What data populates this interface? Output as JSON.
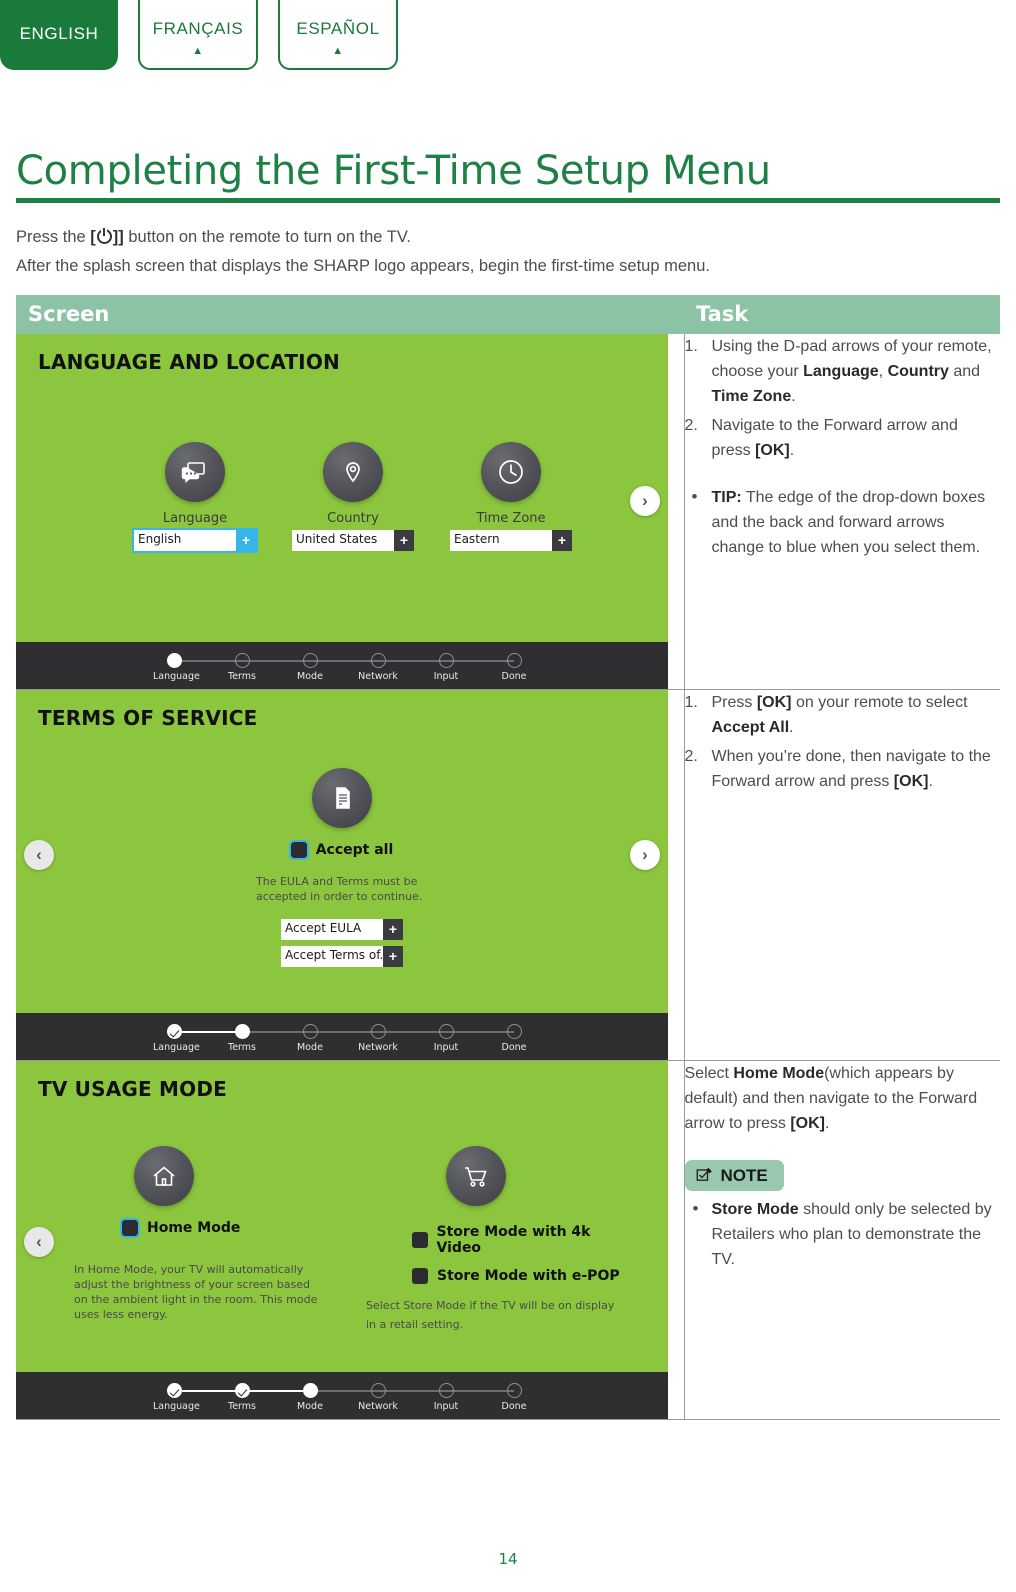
{
  "language_tabs": [
    {
      "label": "ENGLISH",
      "active": true
    },
    {
      "label": "FRANÇAIS",
      "active": false
    },
    {
      "label": "ESPAÑOL",
      "active": false
    }
  ],
  "page_title": "Completing the First-Time Setup Menu",
  "intro": {
    "line1_a": "Press the ",
    "line1_b": "[",
    "line1_c": "]]",
    "line1_d": " button on the remote to turn on the TV.",
    "line2": "After the splash screen that displays the SHARP logo appears, begin the first-time setup menu."
  },
  "table_headers": {
    "screen": "Screen",
    "task": "Task"
  },
  "colors": {
    "brand_green": "#1e8045",
    "tv_green": "#8cc63e",
    "header_sage": "#8dc3a5",
    "highlight_blue": "#35b6e8",
    "footer_dark": "#2f2f32",
    "note_green": "#9ac8ae"
  },
  "steps": [
    "Language",
    "Terms",
    "Mode",
    "Network",
    "Input",
    "Done"
  ],
  "row1": {
    "screen_title": "LANGUAGE AND LOCATION",
    "options": [
      {
        "label": "Language",
        "value": "English",
        "icon": "chat-bubble-icon",
        "selected": true
      },
      {
        "label": "Country",
        "value": "United States",
        "icon": "location-pin-icon",
        "selected": false
      },
      {
        "label": "Time Zone",
        "value": "Eastern",
        "icon": "clock-icon",
        "selected": false
      }
    ],
    "plus_symbol": "+",
    "forward_arrow": "›",
    "current_step": "Language",
    "tasks": [
      {
        "parts": [
          {
            "t": "Using the D-pad arrows of your remote, choose your ",
            "b": false
          },
          {
            "t": "Language",
            "b": true
          },
          {
            "t": ", ",
            "b": false
          },
          {
            "t": "Country",
            "b": true
          },
          {
            "t": " and ",
            "b": false
          },
          {
            "t": "Time Zone",
            "b": true
          },
          {
            "t": ".",
            "b": false
          }
        ]
      },
      {
        "parts": [
          {
            "t": "Navigate to the Forward arrow and press ",
            "b": false
          },
          {
            "t": "[OK]",
            "b": true
          },
          {
            "t": ".",
            "b": false
          }
        ]
      }
    ],
    "tip": [
      {
        "t": "TIP:",
        "b": true
      },
      {
        "t": " The edge of the drop-down boxes and the back and forward arrows change to blue when you select them.",
        "b": false
      }
    ]
  },
  "row2": {
    "screen_title": "TERMS OF SERVICE",
    "icon": "document-icon",
    "accept_all_label": "Accept all",
    "helper_text": "The EULA and Terms must be accepted in order to continue.",
    "dropdowns": [
      {
        "value": "Accept EULA"
      },
      {
        "value": "Accept Terms of..."
      }
    ],
    "plus_symbol": "+",
    "back_arrow": "‹",
    "forward_arrow": "›",
    "current_step": "Terms",
    "completed_steps": [
      "Language"
    ],
    "tasks": [
      {
        "parts": [
          {
            "t": "Press ",
            "b": false
          },
          {
            "t": "[OK]",
            "b": true
          },
          {
            "t": " on your remote to select ",
            "b": false
          },
          {
            "t": "Accept All",
            "b": true
          },
          {
            "t": ".",
            "b": false
          }
        ]
      },
      {
        "parts": [
          {
            "t": "When you’re done, then navigate to the Forward arrow and press ",
            "b": false
          },
          {
            "t": "[OK]",
            "b": true
          },
          {
            "t": ".",
            "b": false
          }
        ]
      }
    ]
  },
  "row3": {
    "screen_title": "TV USAGE MODE",
    "home": {
      "icon": "home-icon",
      "label": "Home Mode",
      "selected": true,
      "description": "In Home Mode, your TV will automatically adjust the brightness of your screen based on the ambient light in the room. This mode uses less energy."
    },
    "store": {
      "icon": "shopping-cart-icon",
      "options": [
        {
          "label": "Store Mode with 4k Video",
          "selected": false
        },
        {
          "label": "Store Mode with e-POP",
          "selected": false
        }
      ],
      "description": "Select Store Mode if the TV will be on display in a retail setting."
    },
    "back_arrow": "‹",
    "current_step": "Mode",
    "completed_steps": [
      "Language",
      "Terms"
    ],
    "task_paragraph": [
      {
        "t": "Select ",
        "b": false
      },
      {
        "t": "Home Mode",
        "b": true
      },
      {
        "t": "(which appears by default) and then navigate to the Forward arrow to press ",
        "b": false
      },
      {
        "t": "[OK]",
        "b": true
      },
      {
        "t": ".",
        "b": false
      }
    ],
    "note_label": "NOTE",
    "note_icon": "checkbox-pencil-icon",
    "note_items": [
      [
        {
          "t": "Store Mode",
          "b": true
        },
        {
          "t": " should only be selected by Retailers who plan to demonstrate the TV.",
          "b": false
        }
      ]
    ]
  },
  "footer": {
    "page_number": "14"
  }
}
